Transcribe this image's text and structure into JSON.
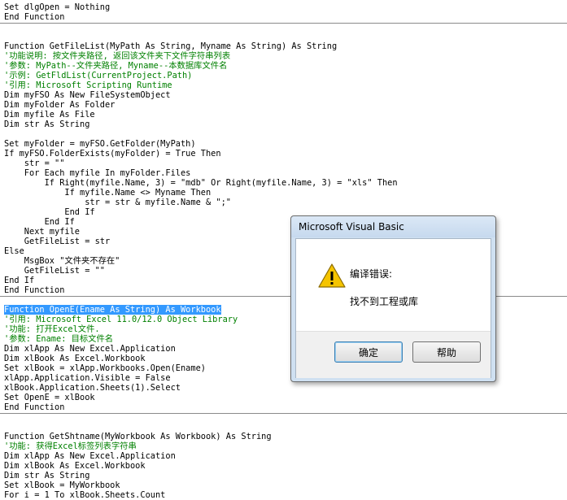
{
  "code": {
    "lines": [
      {
        "text": "Set dlgOpen = Nothing",
        "type": "code"
      },
      {
        "text": "End Function",
        "type": "code"
      },
      {
        "text": "",
        "type": "code"
      },
      {
        "text": "Function GetFileList(MyPath As String, Myname As String) As String",
        "type": "code"
      },
      {
        "text": "'功能说明: 按文件夹路径, 返回该文件夹下文件字符串列表",
        "type": "comment"
      },
      {
        "text": "'参数: MyPath--文件夹路径, Myname--本数据库文件名",
        "type": "comment"
      },
      {
        "text": "'示例: GetFldList(CurrentProject.Path)",
        "type": "comment"
      },
      {
        "text": "'引用: Microsoft Scripting Runtime",
        "type": "comment"
      },
      {
        "text": "Dim myFSO As New FileSystemObject",
        "type": "code"
      },
      {
        "text": "Dim myFolder As Folder",
        "type": "code"
      },
      {
        "text": "Dim myfile As File",
        "type": "code"
      },
      {
        "text": "Dim str As String",
        "type": "code"
      },
      {
        "text": "",
        "type": "code"
      },
      {
        "text": "Set myFolder = myFSO.GetFolder(MyPath)",
        "type": "code"
      },
      {
        "text": "If myFSO.FolderExists(myFolder) = True Then",
        "type": "code"
      },
      {
        "text": "    str = \"\"",
        "type": "code"
      },
      {
        "text": "    For Each myfile In myFolder.Files",
        "type": "code"
      },
      {
        "text": "        If Right(myfile.Name, 3) = \"mdb\" Or Right(myfile.Name, 3) = \"xls\" Then",
        "type": "code"
      },
      {
        "text": "            If myfile.Name <> Myname Then",
        "type": "code"
      },
      {
        "text": "                str = str & myfile.Name & \";\"",
        "type": "code"
      },
      {
        "text": "            End If",
        "type": "code"
      },
      {
        "text": "        End If",
        "type": "code"
      },
      {
        "text": "    Next myfile",
        "type": "code"
      },
      {
        "text": "    GetFileList = str",
        "type": "code"
      },
      {
        "text": "Else",
        "type": "code"
      },
      {
        "text": "    MsgBox \"文件夹不存在\"",
        "type": "code"
      },
      {
        "text": "    GetFileList = \"\"",
        "type": "code"
      },
      {
        "text": "End If",
        "type": "code"
      },
      {
        "text": "End Function",
        "type": "code"
      },
      {
        "text": "Function OpenE(Ename As String) As Workbook",
        "type": "selected"
      },
      {
        "text": "'引用: Microsoft Excel 11.0/12.0 Object Library",
        "type": "comment"
      },
      {
        "text": "'功能: 打开Excel文件.",
        "type": "comment"
      },
      {
        "text": "'参数: Ename: 目标文件名",
        "type": "comment"
      },
      {
        "text": "Dim xlApp As New Excel.Application",
        "type": "code"
      },
      {
        "text": "Dim xlBook As Excel.Workbook",
        "type": "code"
      },
      {
        "text": "Set xlBook = xlApp.Workbooks.Open(Ename)",
        "type": "code"
      },
      {
        "text": "xlApp.Application.Visible = False",
        "type": "code"
      },
      {
        "text": "xlBook.Application.Sheets(1).Select",
        "type": "code"
      },
      {
        "text": "Set OpenE = xlBook",
        "type": "code"
      },
      {
        "text": "End Function",
        "type": "code"
      },
      {
        "text": "",
        "type": "code"
      },
      {
        "text": "Function GetShtname(MyWorkbook As Workbook) As String",
        "type": "code"
      },
      {
        "text": "'功能: 获得Excel标签列表字符串",
        "type": "comment"
      },
      {
        "text": "Dim xlApp As New Excel.Application",
        "type": "code"
      },
      {
        "text": "Dim xlBook As Excel.Workbook",
        "type": "code"
      },
      {
        "text": "Dim str As String",
        "type": "code"
      },
      {
        "text": "Set xlBook = MyWorkbook",
        "type": "code"
      },
      {
        "text": "For i = 1 To xlBook.Sheets.Count",
        "type": "code"
      }
    ]
  },
  "dialog": {
    "title": "Microsoft Visual Basic",
    "icon": "warning-icon",
    "heading": "编译错误:",
    "message": "找不到工程或库",
    "ok_label": "确定",
    "help_label": "帮助"
  },
  "colors": {
    "comment": "#008000",
    "selection": "#3399ff",
    "warning_yellow": "#f5c400"
  }
}
